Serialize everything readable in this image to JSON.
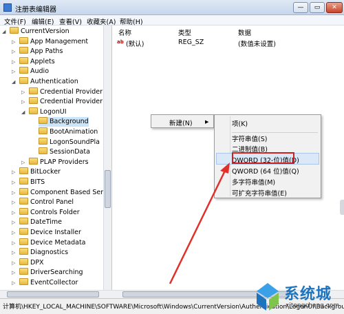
{
  "window": {
    "title": "注册表编辑器",
    "min_btn": "—",
    "max_btn": "▭",
    "close_btn": "✕"
  },
  "menu": [
    "文件(F)",
    "编辑(E)",
    "查看(V)",
    "收藏夹(A)",
    "帮助(H)"
  ],
  "tree": [
    {
      "label": "CurrentVersion",
      "level": 0
    },
    {
      "label": "App Management",
      "level": 1
    },
    {
      "label": "App Paths",
      "level": 1
    },
    {
      "label": "Applets",
      "level": 1
    },
    {
      "label": "Audio",
      "level": 1
    },
    {
      "label": "Authentication",
      "level": 1
    },
    {
      "label": "Credential Provider",
      "level": 2
    },
    {
      "label": "Credential Provider",
      "level": 2
    },
    {
      "label": "LogonUI",
      "level": 2
    },
    {
      "label": "Background",
      "level": 3,
      "selected": true
    },
    {
      "label": "BootAnimation",
      "level": 3
    },
    {
      "label": "LogonSoundPla",
      "level": 3
    },
    {
      "label": "SessionData",
      "level": 3
    },
    {
      "label": "PLAP Providers",
      "level": 2
    },
    {
      "label": "BitLocker",
      "level": 1
    },
    {
      "label": "BITS",
      "level": 1
    },
    {
      "label": "Component Based Ser",
      "level": 1
    },
    {
      "label": "Control Panel",
      "level": 1
    },
    {
      "label": "Controls Folder",
      "level": 1
    },
    {
      "label": "DateTime",
      "level": 1
    },
    {
      "label": "Device Installer",
      "level": 1
    },
    {
      "label": "Device Metadata",
      "level": 1
    },
    {
      "label": "Diagnostics",
      "level": 1
    },
    {
      "label": "DPX",
      "level": 1
    },
    {
      "label": "DriverSearching",
      "level": 1
    },
    {
      "label": "EventCollector",
      "level": 1
    }
  ],
  "columns": {
    "name": "名称",
    "type": "类型",
    "data": "数据"
  },
  "values": [
    {
      "name": "(默认)",
      "type": "REG_SZ",
      "data": "(数值未设置)",
      "icon": "ab"
    }
  ],
  "context_menu": {
    "new_label": "新建(N)",
    "submenu_arrow": "▶"
  },
  "submenu": [
    "项(K)",
    "字符串值(S)",
    "二进制值(B)",
    "DWORD (32-位)值(D)",
    "QWORD (64 位)值(Q)",
    "多字符串值(M)",
    "可扩充字符串值(E)"
  ],
  "status_path": "计算机\\HKEY_LOCAL_MACHINE\\SOFTWARE\\Microsoft\\Windows\\CurrentVersion\\Authentication\\LogonUI\\Background",
  "watermark": {
    "brand": "系统城",
    "url": "xitongcheng.com"
  },
  "colors": {
    "highlight_box": "#d0201c",
    "arrow": "#e0302a",
    "selection": "#cce4f7"
  }
}
